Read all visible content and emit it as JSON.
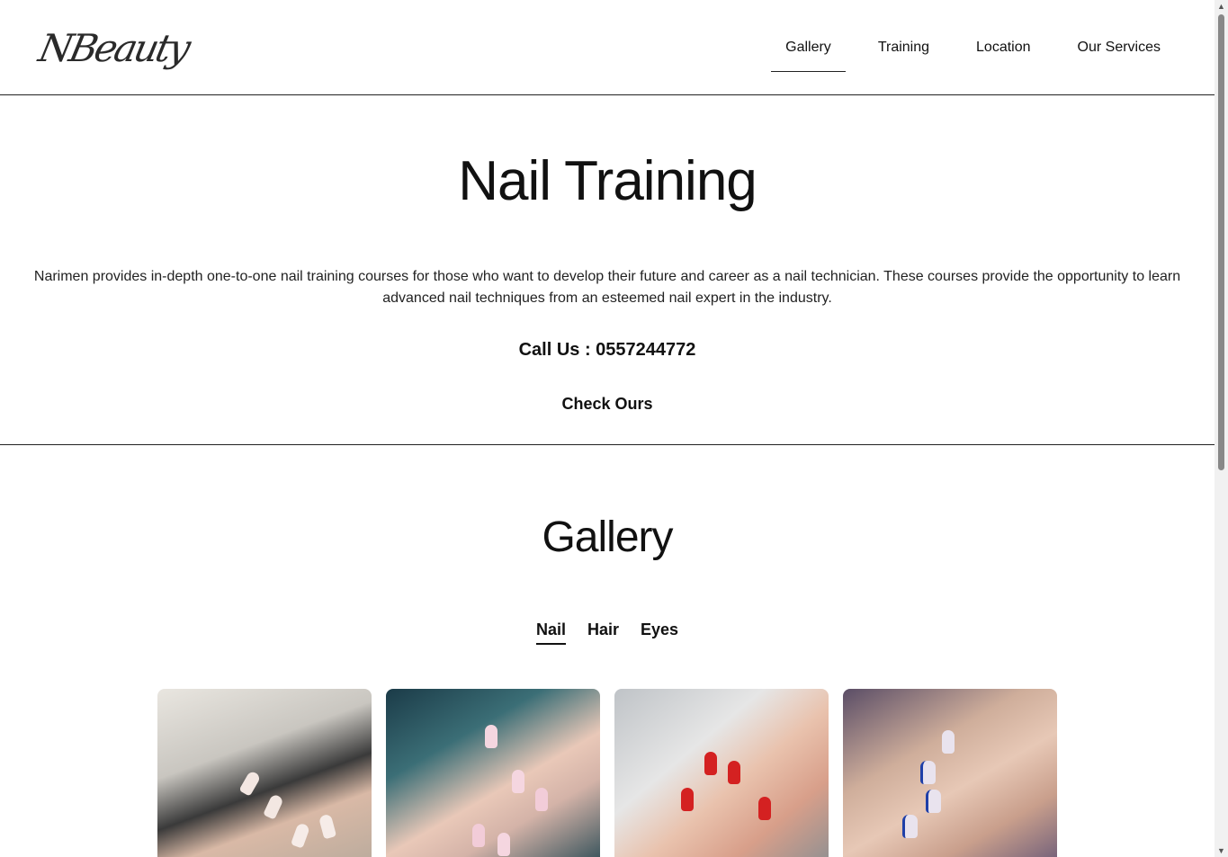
{
  "header": {
    "logo_text": "NBeauty",
    "nav": [
      {
        "label": "Gallery",
        "active": true
      },
      {
        "label": "Training",
        "active": false
      },
      {
        "label": "Location",
        "active": false
      },
      {
        "label": "Our Services",
        "active": false
      }
    ]
  },
  "hero": {
    "title": "Nail Training",
    "description": "Narimen provides in-depth one-to-one nail training courses for those who want to develop their future and career as a nail technician. These courses provide the opportunity to learn advanced nail techniques from an esteemed nail expert in the industry.",
    "call": "Call Us : 0557244772",
    "check": "Check Ours"
  },
  "gallery": {
    "title": "Gallery",
    "tabs": [
      {
        "label": "Nail",
        "active": true
      },
      {
        "label": "Hair",
        "active": false
      },
      {
        "label": "Eyes",
        "active": false
      }
    ],
    "images": [
      {
        "name": "french-tip-nails"
      },
      {
        "name": "pink-ombre-nails"
      },
      {
        "name": "red-french-nails"
      },
      {
        "name": "blue-art-nails"
      }
    ]
  },
  "colors": {
    "text": "#111111",
    "border": "#222222",
    "background": "#ffffff"
  }
}
